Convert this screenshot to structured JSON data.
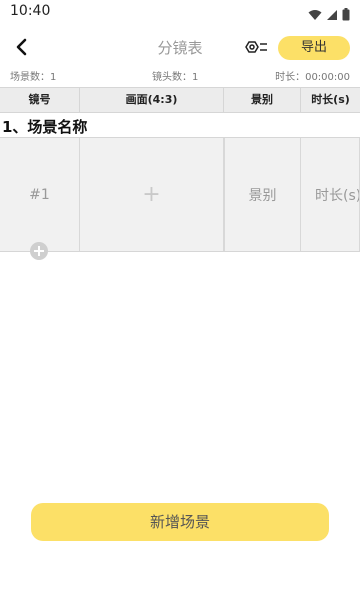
{
  "status_bar": {
    "time": "10:40",
    "icons": [
      "wifi-icon",
      "signal-icon",
      "battery-icon"
    ]
  },
  "header": {
    "title": "分镜表",
    "export_label": "导出",
    "icons": [
      "back-arrow-icon",
      "settings-list-icon"
    ]
  },
  "stats": {
    "scene_count": "场景数：1",
    "shot_count": "镜头数：1",
    "duration": "时长：00:00:00"
  },
  "table": {
    "columns": [
      "镜号",
      "画面(4:3)",
      "景别",
      "时长(s)"
    ]
  },
  "scene": {
    "title": "1、场景名称",
    "rows": [
      {
        "shot_no": "#1",
        "image": "+",
        "shot_size": "景别",
        "duration": "时长(s)"
      }
    ]
  },
  "add_scene_label": "新增场景",
  "colors": {
    "accent": "#fce067",
    "header_bg": "#ececec",
    "cell_bg": "#f1f1f1"
  }
}
